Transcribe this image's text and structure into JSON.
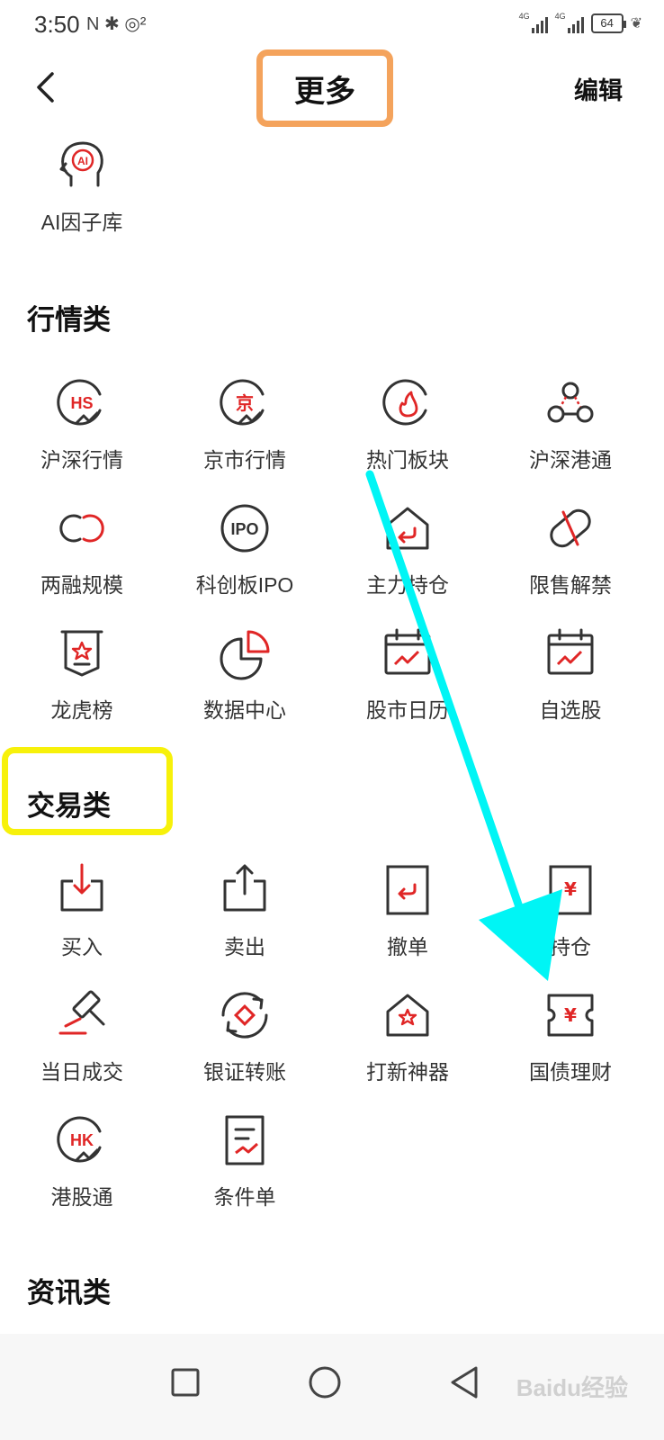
{
  "status_bar": {
    "time": "3:50",
    "left_icons": "N ✱ ◎²",
    "network_tag": "4G",
    "battery": "64"
  },
  "header": {
    "title": "更多",
    "edit_label": "编辑"
  },
  "top_item": {
    "label": "AI因子库",
    "icon": "ai-head-icon"
  },
  "sections": {
    "market": {
      "title": "行情类",
      "items": [
        {
          "label": "沪深行情",
          "icon": "hs-market-icon"
        },
        {
          "label": "京市行情",
          "icon": "beijing-market-icon"
        },
        {
          "label": "热门板块",
          "icon": "hot-sector-icon"
        },
        {
          "label": "沪深港通",
          "icon": "connect-icon"
        },
        {
          "label": "两融规模",
          "icon": "margin-icon"
        },
        {
          "label": "科创板IPO",
          "icon": "ipo-icon"
        },
        {
          "label": "主力持仓",
          "icon": "main-holding-icon"
        },
        {
          "label": "限售解禁",
          "icon": "unlock-icon"
        },
        {
          "label": "龙虎榜",
          "icon": "dragon-tiger-icon"
        },
        {
          "label": "数据中心",
          "icon": "data-center-icon"
        },
        {
          "label": "股市日历",
          "icon": "calendar-icon"
        },
        {
          "label": "自选股",
          "icon": "watchlist-icon"
        }
      ]
    },
    "trade": {
      "title": "交易类",
      "items": [
        {
          "label": "买入",
          "icon": "buy-icon"
        },
        {
          "label": "卖出",
          "icon": "sell-icon"
        },
        {
          "label": "撤单",
          "icon": "cancel-order-icon"
        },
        {
          "label": "持仓",
          "icon": "position-icon"
        },
        {
          "label": "当日成交",
          "icon": "auction-hammer-icon"
        },
        {
          "label": "银证转账",
          "icon": "transfer-icon"
        },
        {
          "label": "打新神器",
          "icon": "new-share-icon"
        },
        {
          "label": "国债理财",
          "icon": "bond-ticket-icon"
        },
        {
          "label": "港股通",
          "icon": "hk-connect-icon"
        },
        {
          "label": "条件单",
          "icon": "condition-order-icon"
        }
      ]
    },
    "news": {
      "title": "资讯类"
    }
  },
  "watermark": "Baidu经验",
  "colors": {
    "accent_red": "#e02626",
    "icon_dark": "#333333",
    "highlight_orange": "#f4a35c",
    "highlight_yellow": "#f7f10a",
    "arrow_cyan": "#00f5f5"
  }
}
